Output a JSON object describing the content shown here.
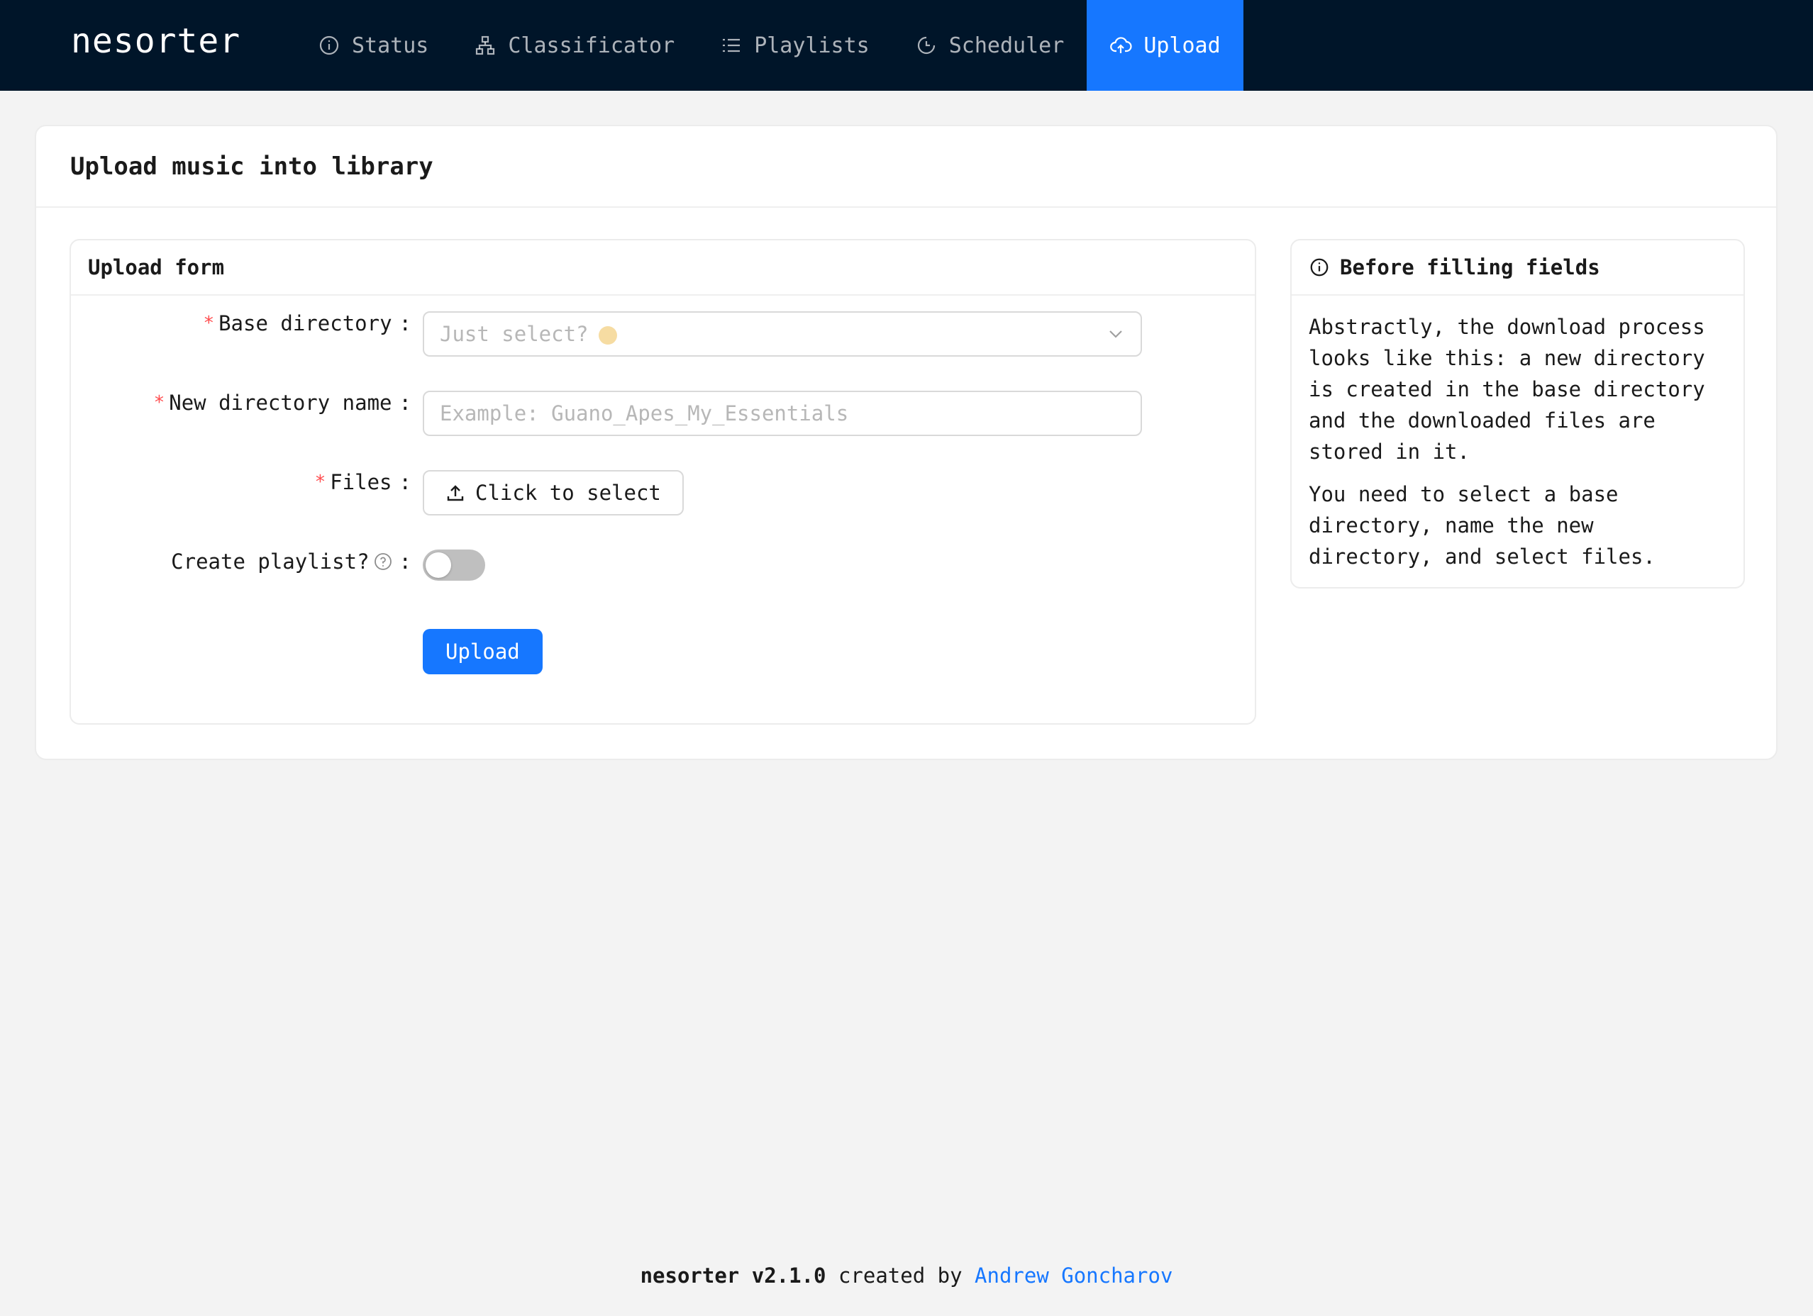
{
  "app": {
    "logo": "nesorter"
  },
  "nav": {
    "items": [
      {
        "label": "Status",
        "icon": "info-circle-icon",
        "active": false
      },
      {
        "label": "Classificator",
        "icon": "hierarchy-icon",
        "active": false
      },
      {
        "label": "Playlists",
        "icon": "list-icon",
        "active": false
      },
      {
        "label": "Scheduler",
        "icon": "clock-icon",
        "active": false
      },
      {
        "label": "Upload",
        "icon": "cloud-upload-icon",
        "active": true
      }
    ],
    "active_color": "#1677ff",
    "background": "#001529"
  },
  "page": {
    "title": "Upload music into library"
  },
  "form": {
    "title": "Upload form",
    "base_directory": {
      "label": "Base directory",
      "required": true,
      "placeholder": "Just select?"
    },
    "new_directory": {
      "label": "New directory name",
      "required": true,
      "placeholder": "Example: Guano_Apes_My_Essentials"
    },
    "files": {
      "label": "Files",
      "required": true,
      "button_label": "Click to select"
    },
    "create_playlist": {
      "label": "Create playlist?",
      "checked": false
    },
    "submit_label": "Upload"
  },
  "info": {
    "title": "Before filling fields",
    "paragraph1": "Abstractly, the download process looks like this: a new directory is created in the base directory and the downloaded files are stored in it.",
    "paragraph2": "You need to select a base directory, name the new directory, and select files."
  },
  "footer": {
    "version_text": "nesorter v2.1.0",
    "created_by": "created by",
    "author": "Andrew Goncharov"
  }
}
